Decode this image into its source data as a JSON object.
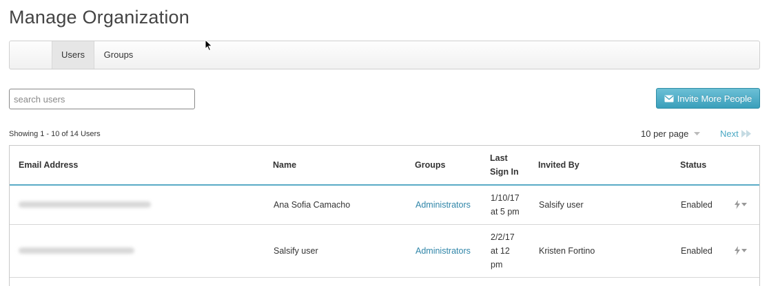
{
  "page": {
    "title": "Manage Organization"
  },
  "tabs": [
    {
      "label": "Users"
    },
    {
      "label": "Groups"
    }
  ],
  "search": {
    "placeholder": "search users",
    "value": ""
  },
  "invite_button": {
    "label": "Invite More People",
    "icon": "envelope-icon"
  },
  "pagination": {
    "showing": "Showing 1 - 10 of 14 Users",
    "per_page": "10 per page",
    "next": "Next"
  },
  "table": {
    "headers": {
      "email": "Email Address",
      "name": "Name",
      "groups": "Groups",
      "last_sign_in_1": "Last",
      "last_sign_in_2": "Sign In",
      "invited_by": "Invited By",
      "status": "Status"
    },
    "rows": [
      {
        "name": "Ana Sofia Camacho",
        "groups": "Administrators",
        "last_1": "1/10/17",
        "last_2": "at 5 pm",
        "last_3": "",
        "invited_by": "Salsify user",
        "status": "Enabled"
      },
      {
        "name": "Salsify user",
        "groups": "Administrators",
        "last_1": "2/2/17",
        "last_2": "at 12",
        "last_3": "pm",
        "invited_by": "Kristen Fortino",
        "status": "Enabled"
      }
    ]
  },
  "colors": {
    "accent": "#3a9fbb",
    "link": "#2f85a8",
    "header_rule": "#58aac6"
  }
}
